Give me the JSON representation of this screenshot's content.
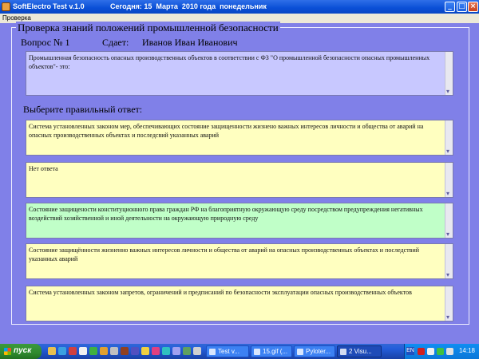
{
  "window": {
    "title": "SoftElectro",
    "version": "Test v.1.0",
    "date_text": "Сегодня: 15  Марта  2010 года  понедельник",
    "minimize": "_",
    "maximize": "□",
    "close": "×"
  },
  "menu": {
    "items": [
      "Проверка"
    ]
  },
  "group_title": "Проверка знаний положений промышленной безопасности",
  "question": {
    "number_label": "Вопрос № 1",
    "examinee_label": "Сдает:",
    "examinee_name": "Иванов Иван Иванович",
    "text": "Промышленная безопасность опасных производственных объектов в соответствии с ФЗ \"О промышленной безопасности опасных промышленных объектов\"- это:"
  },
  "choose_label": "Выберите правильный ответ:",
  "answers": [
    {
      "text": "Система установленных законом мер, обеспечивающих состояние защищенности жизнено важных интересов личности и общества от аварий на опасных производственных объектах и последсвий указанных аварий",
      "color": "#ffffc0"
    },
    {
      "text": "Нет ответа",
      "color": "#ffffc0"
    },
    {
      "text": "Состояние защищености конституционного права граждан РФ на благоприятную окружающую среду посредством предупреждения негативных воздействий хозяйственной и иной деятельности на окружающую  природную среду",
      "color": "#c0ffc8"
    },
    {
      "text": "Состояние защищённости жизненно важных интересов личности и общества от аварий на опасных производственных объектах и последствий указанных аварий",
      "color": "#ffffc0"
    },
    {
      "text": "Система установленных законом запретов, ограничений и предписаний по безопасности эксплуатации опасных производственных объектов",
      "color": "#ffffc0"
    }
  ],
  "taskbar": {
    "start_label": "пуск",
    "tasks": [
      "Test v...",
      "15.gif (...",
      "Pyloter...",
      "2 Visu..."
    ],
    "clock": "14:18",
    "lang": "EN"
  },
  "colors": {
    "main_bg": "#8080e8",
    "question_bg": "#c8c8ff",
    "answer_bg": "#ffffc0",
    "selected_answer_bg": "#c0ffc8"
  }
}
